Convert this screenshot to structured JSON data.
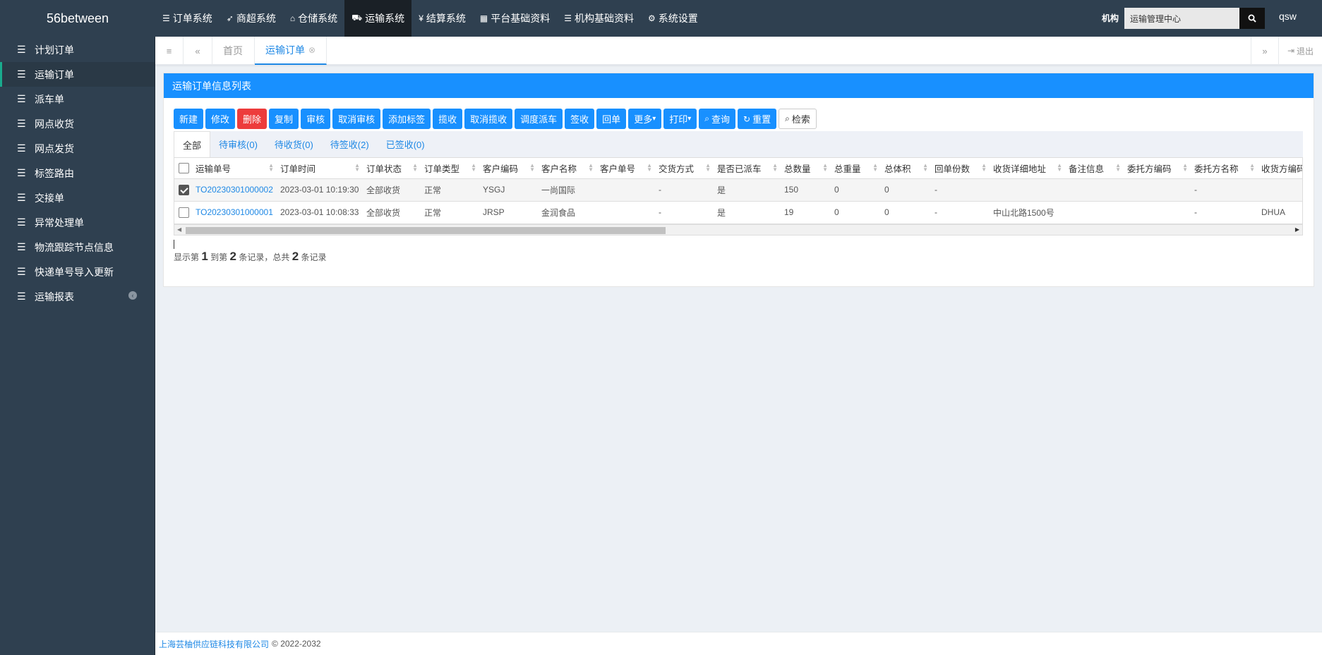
{
  "brand": "56between",
  "topnav": [
    {
      "icon": "list-icon",
      "glyph": "☰",
      "label": "订单系统"
    },
    {
      "icon": "rocket-icon",
      "glyph": "➶",
      "label": "商超系统"
    },
    {
      "icon": "home-icon",
      "glyph": "⌂",
      "label": "仓储系统"
    },
    {
      "icon": "truck-icon",
      "glyph": "⛟",
      "label": "运输系统"
    },
    {
      "icon": "yen-icon",
      "glyph": "¥",
      "label": "结算系统"
    },
    {
      "icon": "grid-icon",
      "glyph": "▦",
      "label": "平台基础资料"
    },
    {
      "icon": "list-icon",
      "glyph": "☰",
      "label": "机构基础资料"
    },
    {
      "icon": "gear-icon",
      "glyph": "⚙",
      "label": "系统设置"
    }
  ],
  "org": {
    "label": "机构",
    "value": "运输管理中心"
  },
  "user": "qsw",
  "sidebar": [
    {
      "label": "计划订单"
    },
    {
      "label": "运输订单"
    },
    {
      "label": "派车单"
    },
    {
      "label": "网点收货"
    },
    {
      "label": "网点发货"
    },
    {
      "label": "标签路由"
    },
    {
      "label": "交接单"
    },
    {
      "label": "异常处理单"
    },
    {
      "label": "物流跟踪节点信息"
    },
    {
      "label": "快递单号导入更新"
    },
    {
      "label": "运输报表"
    }
  ],
  "tabs": {
    "home": "首页",
    "current": "运输订单",
    "logout": "退出"
  },
  "panel": {
    "title": "运输订单信息列表"
  },
  "toolbar": [
    "新建",
    "修改",
    "删除",
    "复制",
    "审核",
    "取消审核",
    "添加标签",
    "揽收",
    "取消揽收",
    "调度派车",
    "签收",
    "回单",
    "更多",
    "打印",
    "查询",
    "重置",
    "检索"
  ],
  "subtabs": [
    "全部",
    "待审核(0)",
    "待收货(0)",
    "待签收(2)",
    "已签收(0)"
  ],
  "columns": [
    "运输单号",
    "订单时间",
    "订单状态",
    "订单类型",
    "客户编码",
    "客户名称",
    "客户单号",
    "交货方式",
    "是否已派车",
    "总数量",
    "总重量",
    "总体积",
    "回单份数",
    "收货详细地址",
    "备注信息",
    "委托方编码",
    "委托方名称",
    "收货方编码"
  ],
  "rows": [
    {
      "checked": true,
      "cells": [
        "TO20230301000002",
        "2023-03-01 10:19:30",
        "全部收货",
        "正常",
        "YSGJ",
        "一尚国际",
        "",
        "-",
        "是",
        "150",
        "0",
        "0",
        "-",
        "",
        "",
        "",
        "-",
        ""
      ]
    },
    {
      "checked": false,
      "cells": [
        "TO20230301000001",
        "2023-03-01 10:08:33",
        "全部收货",
        "正常",
        "JRSP",
        "金润食品",
        "",
        "-",
        "是",
        "19",
        "0",
        "0",
        "-",
        "中山北路1500号",
        "",
        "",
        "-",
        "DHUA"
      ]
    }
  ],
  "pageinfo": {
    "p1": "显示第",
    "from": "1",
    "p2": "到第",
    "to": "2",
    "p3": "条记录，总共",
    "total": "2",
    "p4": "条记录"
  },
  "footer": {
    "company": "上海芸柚供应链科技有限公司",
    "copy": "© 2022-2032"
  }
}
